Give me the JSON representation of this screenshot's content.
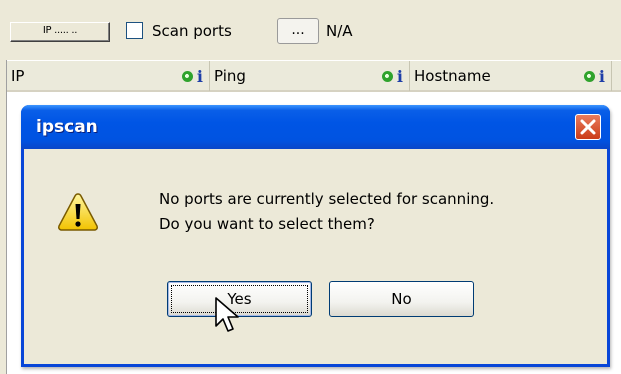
{
  "toolbar": {
    "ip_range_label": "IP ..... ..",
    "scan_ports_label": "Scan ports",
    "browse_label": "...",
    "ports_status": "N/A"
  },
  "columns": [
    {
      "label": "IP"
    },
    {
      "label": "Ping"
    },
    {
      "label": "Hostname"
    }
  ],
  "dialog": {
    "title": "ipscan",
    "message_line1": "No ports are currently selected for scanning.",
    "message_line2": "Do you want to select them?",
    "yes_label": "Yes",
    "no_label": "No"
  },
  "icons": {
    "column_icons": [
      "eye-icon",
      "info-icon"
    ],
    "dialog": "warning-icon",
    "close": "close-icon"
  },
  "colors": {
    "titlebar": "#0055e5",
    "dialog_bg": "#ece9d8",
    "toolbar_bg": "#ece9d8"
  }
}
